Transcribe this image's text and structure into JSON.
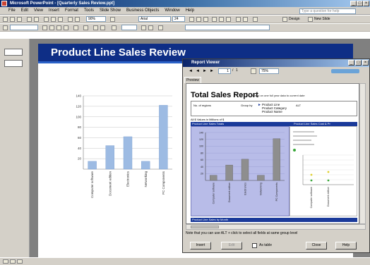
{
  "window": {
    "title": "Microsoft PowerPoint - [Quarterly Sales Review.ppt]"
  },
  "menu": [
    "File",
    "Edit",
    "View",
    "Insert",
    "Format",
    "Tools",
    "Slide Show",
    "Business Objects",
    "Window",
    "Help"
  ],
  "help_box": {
    "placeholder": "Type a question for help"
  },
  "toolbar": {
    "zoom": "90%",
    "font": "Arial",
    "font_size": "24",
    "design_label": "Design",
    "new_slide_label": "New Slide"
  },
  "slide": {
    "title": "Product Line Sales Review"
  },
  "slide_chart": {
    "type": "bar",
    "categories": [
      "Computer software",
      "Document edition",
      "Electronics",
      "Networking",
      "PC Components"
    ],
    "values": [
      15,
      45,
      62,
      15,
      122
    ],
    "yticks": [
      20,
      40,
      60,
      80,
      100,
      120,
      140
    ],
    "ylim": [
      0,
      140
    ],
    "color": "#9dbbe3"
  },
  "viewer": {
    "title": "Report Viewer",
    "page_current": "1",
    "page_total": "1",
    "zoom": "75%",
    "tab_label": "Preview",
    "report": {
      "title": "Total Sales Report",
      "subtitle": "Based on one full year data to current date",
      "filter_label": "No. of regions",
      "group_by_label": "Group by",
      "group_items": [
        "Product Line",
        "Product Category",
        "Product Name"
      ],
      "alt_value": "ALT",
      "section_caption": "All $ Values in Millions of $",
      "panel1_title": "Product Line Sales Totals",
      "panel2_title": "Product Line Sales Cost & Pr",
      "panel3_title": "Product Line Sales by Month",
      "chart": {
        "type": "bar",
        "categories": [
          "Computer software",
          "Document edition",
          "Electronics",
          "Networking",
          "PC Components"
        ],
        "values": [
          15,
          45,
          62,
          15,
          122
        ],
        "yticks": [
          20,
          40,
          60,
          80,
          100,
          120,
          140
        ],
        "ylim": [
          0,
          140
        ],
        "color": "#8e8e8e"
      },
      "chart2": {
        "type": "line",
        "categories": [
          "Computer software",
          "Document edition"
        ]
      }
    },
    "note": "Note that you can use ALT + click to select all fields at same group level",
    "buttons": {
      "insert": "Insert",
      "edit": "Edit",
      "close": "Close",
      "help": "Help"
    },
    "as_table_label": "As table"
  }
}
